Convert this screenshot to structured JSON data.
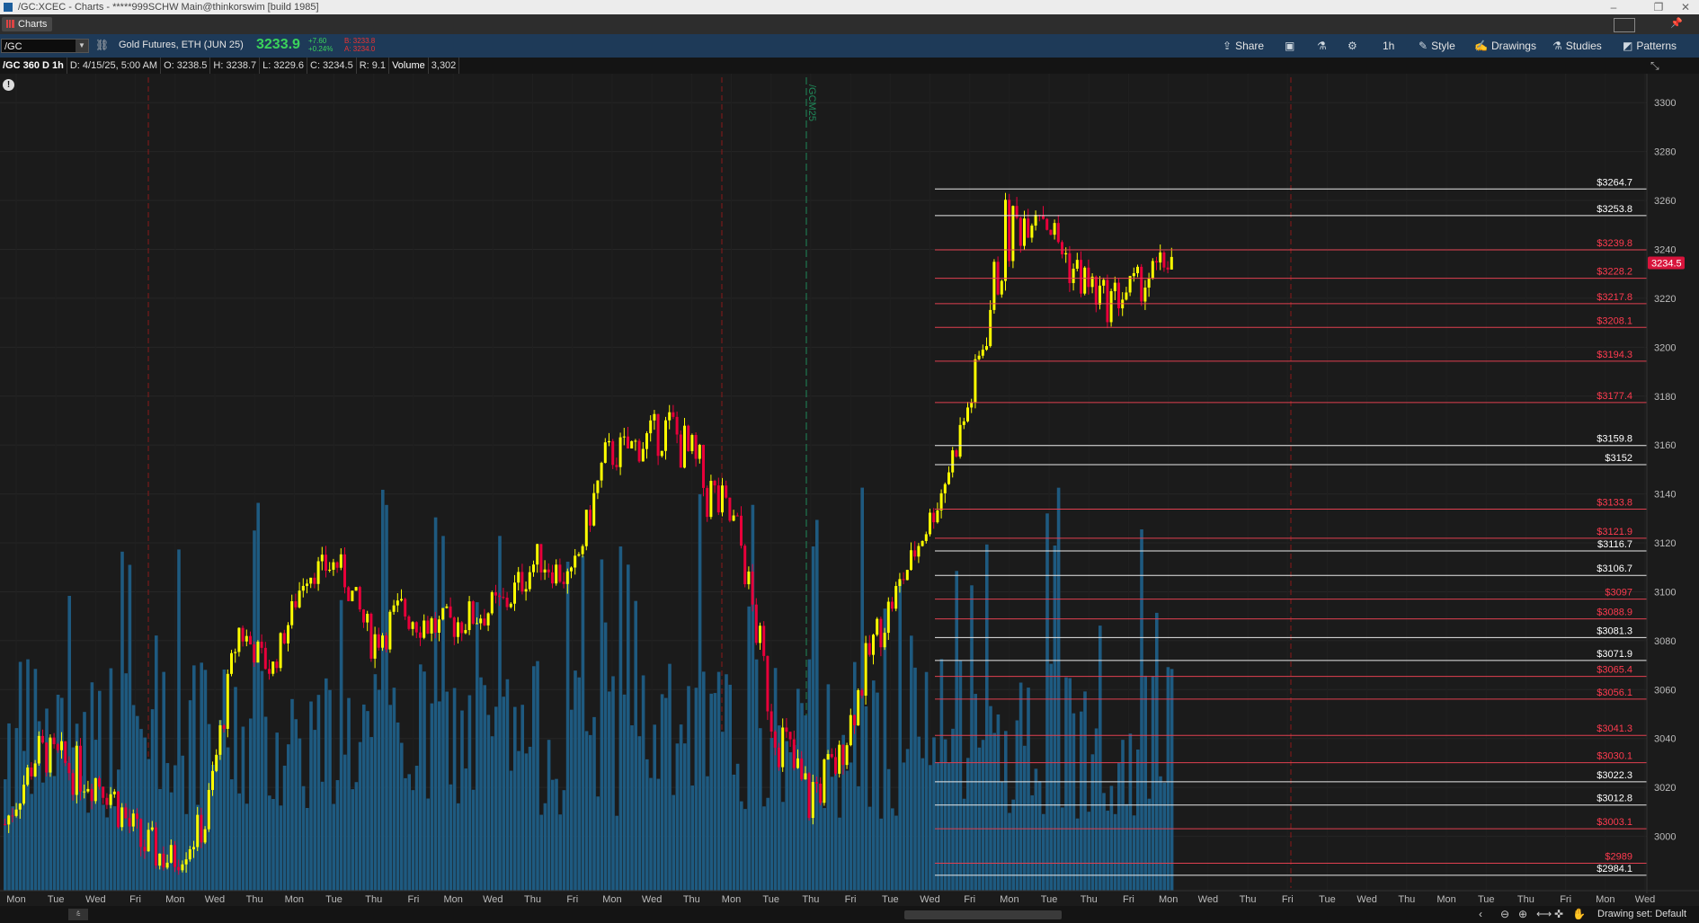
{
  "window": {
    "title": "/GC:XCEC - Charts - *****999SCHW Main@thinkorswim [build 1985]",
    "tab": "Charts"
  },
  "toolbar": {
    "symbol": "/GC",
    "description": "Gold Futures, ETH (JUN 25)",
    "last": "3233.9",
    "change": "+7.60",
    "change_pct": "+0.24%",
    "bid": "B: 3233.8",
    "ask": "A: 3234.0",
    "buttons": {
      "share": "Share",
      "timeframe": "1h",
      "style": "Style",
      "drawings": "Drawings",
      "studies": "Studies",
      "patterns": "Patterns"
    }
  },
  "infobar": {
    "chart_id": "/GC 360 D 1h",
    "date": "D: 4/15/25, 5:00 AM",
    "open": "O: 3238.5",
    "high": "H: 3238.7",
    "low": "L: 3229.6",
    "close": "C: 3234.5",
    "range": "R: 9.1",
    "volume_label": "Volume",
    "volume_value": "3,302"
  },
  "chart_data": {
    "type": "candlestick",
    "price_axis": {
      "min": 2980,
      "max": 3310,
      "ticks": [
        3000,
        3020,
        3040,
        3060,
        3080,
        3100,
        3120,
        3140,
        3160,
        3180,
        3200,
        3220,
        3240,
        3260,
        3280,
        3300
      ]
    },
    "x_labels": [
      "Mon",
      "Tue",
      "Wed",
      "Fri",
      "Mon",
      "Wed",
      "Thu",
      "Mon",
      "Tue",
      "Thu",
      "Fri",
      "Mon",
      "Wed",
      "Thu",
      "Fri",
      "Mon",
      "Wed",
      "Thu",
      "Mon",
      "Tue",
      "Thu",
      "Fri",
      "Tue",
      "Wed",
      "Fri",
      "Mon",
      "Tue",
      "Thu",
      "Fri",
      "Mon",
      "Wed",
      "Thu",
      "Fri",
      "Tue",
      "Wed",
      "Thu",
      "Mon",
      "Tue",
      "Thu",
      "Fri",
      "Mon",
      "Wed"
    ],
    "current_price": "3234.5",
    "contract_label": "/GCM25",
    "levels": [
      {
        "price": 3264.7,
        "label": "$3264.7",
        "color": "white"
      },
      {
        "price": 3253.8,
        "label": "$3253.8",
        "color": "white"
      },
      {
        "price": 3239.8,
        "label": "$3239.8",
        "color": "red"
      },
      {
        "price": 3228.2,
        "label": "$3228.2",
        "color": "red"
      },
      {
        "price": 3217.8,
        "label": "$3217.8",
        "color": "red"
      },
      {
        "price": 3208.1,
        "label": "$3208.1",
        "color": "red"
      },
      {
        "price": 3194.3,
        "label": "$3194.3",
        "color": "red"
      },
      {
        "price": 3177.4,
        "label": "$3177.4",
        "color": "red"
      },
      {
        "price": 3159.8,
        "label": "$3159.8",
        "color": "white"
      },
      {
        "price": 3152,
        "label": "$3152",
        "color": "white"
      },
      {
        "price": 3133.8,
        "label": "$3133.8",
        "color": "red"
      },
      {
        "price": 3121.9,
        "label": "$3121.9",
        "color": "red"
      },
      {
        "price": 3116.7,
        "label": "$3116.7",
        "color": "white"
      },
      {
        "price": 3106.7,
        "label": "$3106.7",
        "color": "white"
      },
      {
        "price": 3097,
        "label": "$3097",
        "color": "red"
      },
      {
        "price": 3088.9,
        "label": "$3088.9",
        "color": "red"
      },
      {
        "price": 3081.3,
        "label": "$3081.3",
        "color": "white"
      },
      {
        "price": 3071.9,
        "label": "$3071.9",
        "color": "white"
      },
      {
        "price": 3065.4,
        "label": "$3065.4",
        "color": "red"
      },
      {
        "price": 3056.1,
        "label": "$3056.1",
        "color": "red"
      },
      {
        "price": 3041.3,
        "label": "$3041.3",
        "color": "red"
      },
      {
        "price": 3030.1,
        "label": "$3030.1",
        "color": "red"
      },
      {
        "price": 3022.3,
        "label": "$3022.3",
        "color": "white"
      },
      {
        "price": 3012.8,
        "label": "$3012.8",
        "color": "white"
      },
      {
        "price": 3003.1,
        "label": "$3003.1",
        "color": "red"
      },
      {
        "price": 2989,
        "label": "$2989",
        "color": "red"
      },
      {
        "price": 2984.1,
        "label": "$2984.1",
        "color": "white"
      }
    ],
    "path": [
      [
        3000,
        3010
      ],
      [
        3030,
        3040
      ],
      [
        3020,
        3035
      ],
      [
        3015,
        3030
      ],
      [
        2990,
        3005
      ],
      [
        2985,
        2995
      ],
      [
        3000,
        3010
      ],
      [
        3080,
        3090
      ],
      [
        3065,
        3070
      ],
      [
        3105,
        3110
      ],
      [
        3108,
        3115
      ],
      [
        3075,
        3085
      ],
      [
        3085,
        3100
      ],
      [
        3080,
        3090
      ],
      [
        3085,
        3095
      ],
      [
        3090,
        3100
      ],
      [
        3110,
        3118
      ],
      [
        3100,
        3108
      ],
      [
        3150,
        3160
      ],
      [
        3155,
        3165
      ],
      [
        3160,
        3175
      ],
      [
        3130,
        3155
      ],
      [
        3120,
        3130
      ],
      [
        3040,
        3060
      ],
      [
        3000,
        3030
      ],
      [
        3025,
        3035
      ],
      [
        3070,
        3085
      ],
      [
        3105,
        3110
      ],
      [
        3134,
        3140
      ],
      [
        3175,
        3185
      ],
      [
        3230,
        3260
      ],
      [
        3255,
        3262
      ],
      [
        3225,
        3240
      ],
      [
        3212,
        3225
      ],
      [
        3220,
        3230
      ],
      [
        3233,
        3240
      ]
    ],
    "colors": {
      "up": "#ffff00",
      "down": "#e8003a",
      "volume": "#1e5a80",
      "white_level": "#e8e8e8",
      "red_level": "#e04050",
      "price_tag": "#d8143c",
      "background": "#1b1b1b"
    }
  },
  "bottom": {
    "drawing_set": "Drawing set: Default"
  }
}
